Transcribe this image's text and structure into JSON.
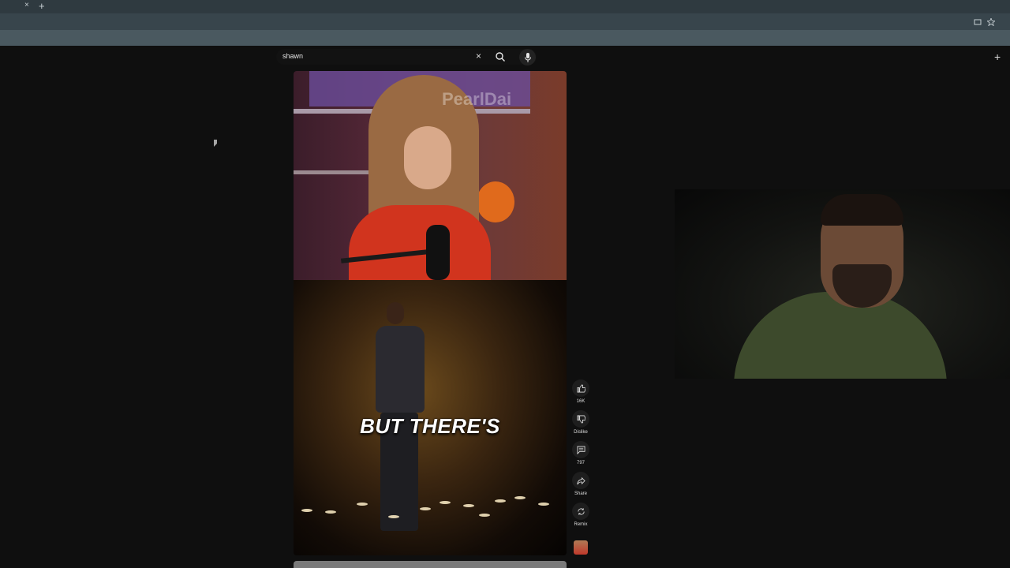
{
  "browser": {
    "tab_close": "×",
    "tab_new": "+"
  },
  "search": {
    "query": "shawn",
    "clear_icon": "×"
  },
  "header": {
    "create_icon": "+"
  },
  "video": {
    "watermark": "PearlDai",
    "caption": "BUT THERE'S"
  },
  "actions": {
    "like_count": "16K",
    "dislike_label": "Dislike",
    "comment_count": "797",
    "share_label": "Share",
    "remix_label": "Remix"
  },
  "icons": [
    "close-icon",
    "plus-icon",
    "search-icon",
    "mic-icon",
    "thumb-up-icon",
    "thumb-down-icon",
    "comment-icon",
    "share-icon",
    "remix-icon"
  ]
}
